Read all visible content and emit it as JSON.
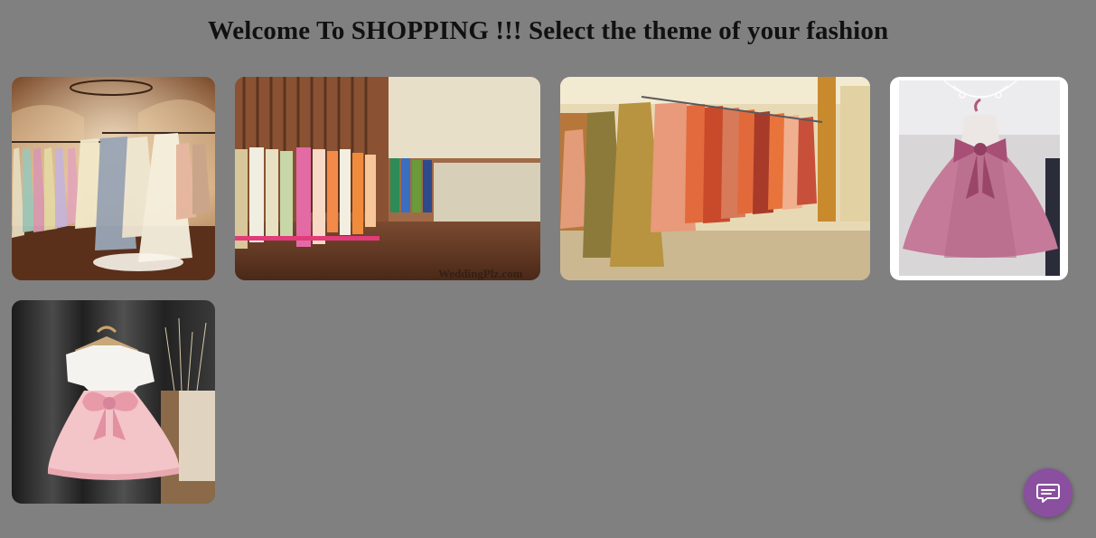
{
  "header": {
    "title": "Welcome To SHOPPING !!! Select the theme of your fashion"
  },
  "gallery": {
    "tiles": [
      {
        "theme": "bridal gowns boutique"
      },
      {
        "theme": "ethnic wear store",
        "watermark": "WeddingPlz.com"
      },
      {
        "theme": "lehenga and saree showroom"
      },
      {
        "theme": "pink bow party frock"
      },
      {
        "theme": "kids pink tutu dress"
      }
    ]
  },
  "chat_widget": {
    "icon": "chat-bubble-icon",
    "color": "#8a4f9e"
  }
}
